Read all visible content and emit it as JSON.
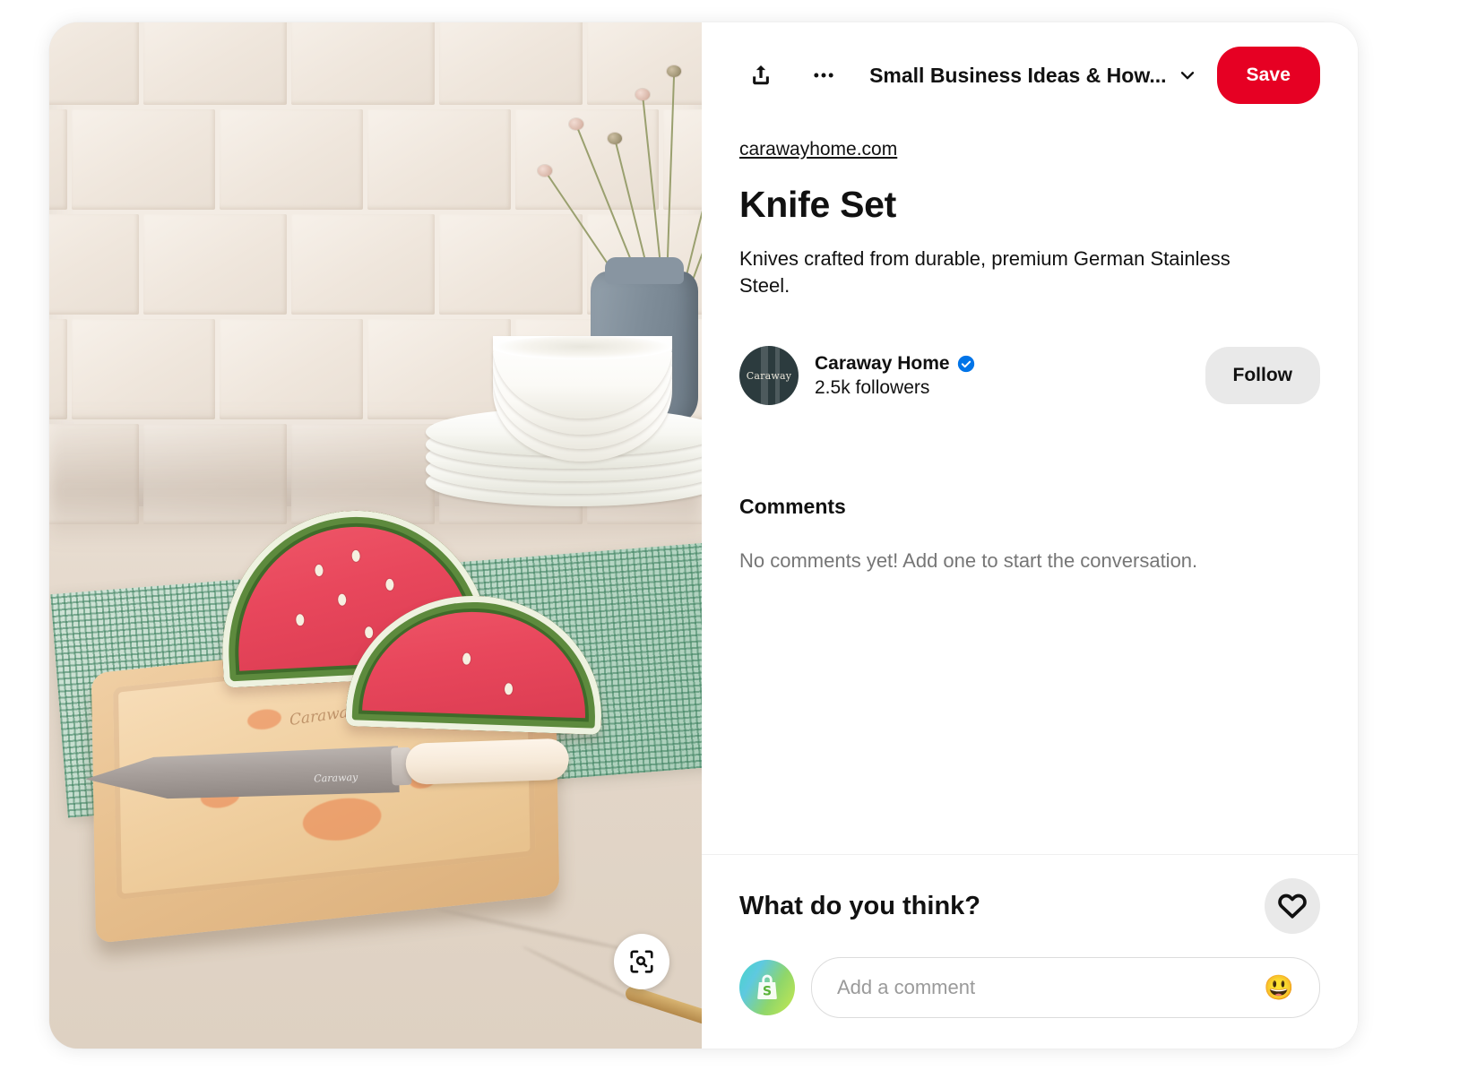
{
  "card": {
    "accent_color": "#e60023",
    "background": "#ffffff"
  },
  "image_pane": {
    "alt": "Caraway knife set with watermelon slices on a wooden cutting board in a kitchen",
    "board_brand_text": "Caraway",
    "blade_brand_text": "Caraway",
    "visual_search_icon": "visual-search-icon"
  },
  "header": {
    "share_icon": "share-icon",
    "more_icon": "more-options-icon",
    "board_name": "Small Business Ideas & How...",
    "chevron_icon": "chevron-down-icon",
    "save_label": "Save"
  },
  "pin": {
    "source_link": "carawayhome.com",
    "title": "Knife Set",
    "description": "Knives crafted from durable, premium German Stainless Steel."
  },
  "creator": {
    "avatar_text": "Caraway",
    "avatar_icon": "brand-avatar",
    "name": "Caraway Home",
    "verified_icon": "verified-badge-icon",
    "followers": "2.5k followers",
    "follow_label": "Follow"
  },
  "comments": {
    "heading": "Comments",
    "empty_text": "No comments yet! Add one to start the conversation."
  },
  "footer": {
    "prompt": "What do you think?",
    "heart_icon": "heart-icon",
    "user_avatar_icon": "shopify-bag-icon",
    "comment_placeholder": "Add a comment",
    "comment_value": "",
    "emoji_icon": "smiley-emoji",
    "emoji_glyph": "😃"
  }
}
